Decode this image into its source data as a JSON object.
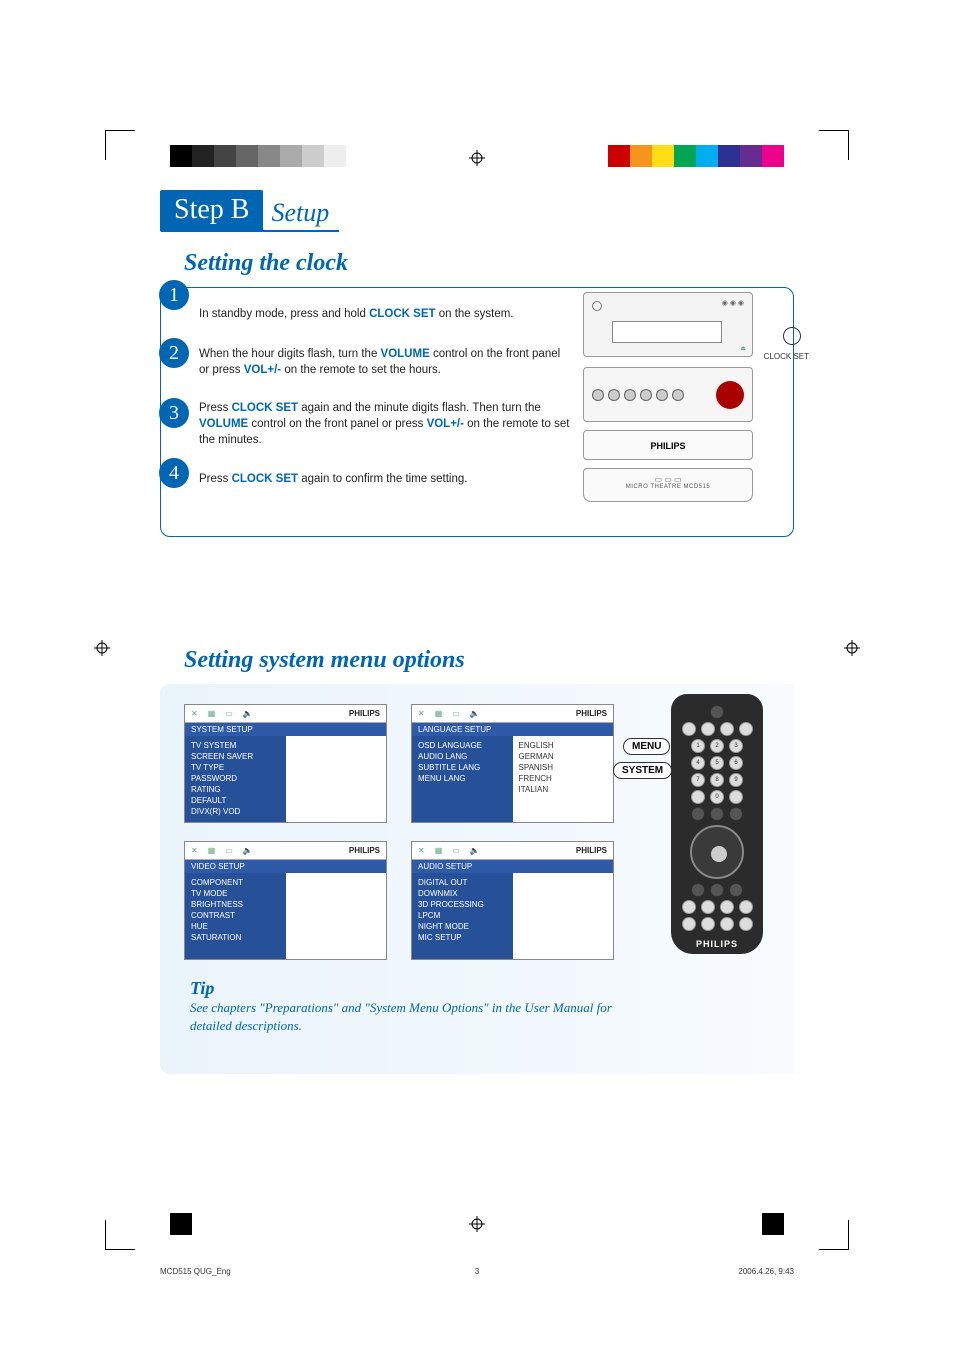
{
  "step": {
    "label": "Step B",
    "sub": "Setup"
  },
  "clock": {
    "title": "Setting the clock",
    "steps": [
      {
        "n": "1",
        "pre": "In standby mode, press and hold ",
        "bold": "CLOCK SET",
        "post": " on the system."
      },
      {
        "n": "2",
        "pre": "When the hour digits flash, turn the ",
        "bold": "VOLUME",
        "mid": " control on the front panel or press ",
        "bold2": "VOL+/-",
        "post": " on the remote to set the hours."
      },
      {
        "n": "3",
        "pre": "Press ",
        "bold": "CLOCK SET",
        "mid": " again and the minute digits flash. Then turn the ",
        "bold2": "VOLUME",
        "mid2": " control on the front panel or press ",
        "bold3": "VOL+/-",
        "post": " on the remote to set the minutes."
      },
      {
        "n": "4",
        "pre": "Press ",
        "bold": "CLOCK SET",
        "post": " again to confirm the time setting."
      }
    ],
    "panel": {
      "clockset": "CLOCK SET",
      "brand": "PHILIPS",
      "sub": "MICRO THEATRE MCD515"
    }
  },
  "menu": {
    "title": "Setting system menu options",
    "osd_brand": "PHILIPS",
    "panels": {
      "system": {
        "bar": "SYSTEM SETUP",
        "left": [
          "TV SYSTEM",
          "SCREEN SAVER",
          "TV TYPE",
          "PASSWORD",
          "RATING",
          "DEFAULT",
          "DIVX(R) VOD"
        ],
        "right": []
      },
      "language": {
        "bar": "LANGUAGE SETUP",
        "left": [
          "OSD LANGUAGE",
          "AUDIO LANG",
          "SUBTITLE LANG",
          "MENU LANG"
        ],
        "right": [
          "ENGLISH",
          "GERMAN",
          "SPANISH",
          "FRENCH",
          "ITALIAN"
        ]
      },
      "video": {
        "bar": "VIDEO SETUP",
        "left": [
          "COMPONENT",
          "TV MODE",
          "BRIGHTNESS",
          "CONTRAST",
          "HUE",
          "SATURATION"
        ],
        "right": []
      },
      "audio": {
        "bar": "AUDIO SETUP",
        "left": [
          "DIGITAL OUT",
          "DOWNMIX",
          "3D PROCESSING",
          "LPCM",
          "NIGHT MODE",
          "MIC SETUP"
        ],
        "right": []
      }
    },
    "callouts": {
      "menu": "MENU",
      "system": "SYSTEM"
    },
    "remote_brand": "PHILIPS",
    "tip": {
      "title": "Tip",
      "text": "See chapters \"Preparations\" and \"System Menu Options\" in the User Manual for detailed descriptions."
    }
  },
  "footer": {
    "left": "MCD515 QUG_Eng",
    "mid": "3",
    "right": "2006.4.26, 9:43"
  }
}
